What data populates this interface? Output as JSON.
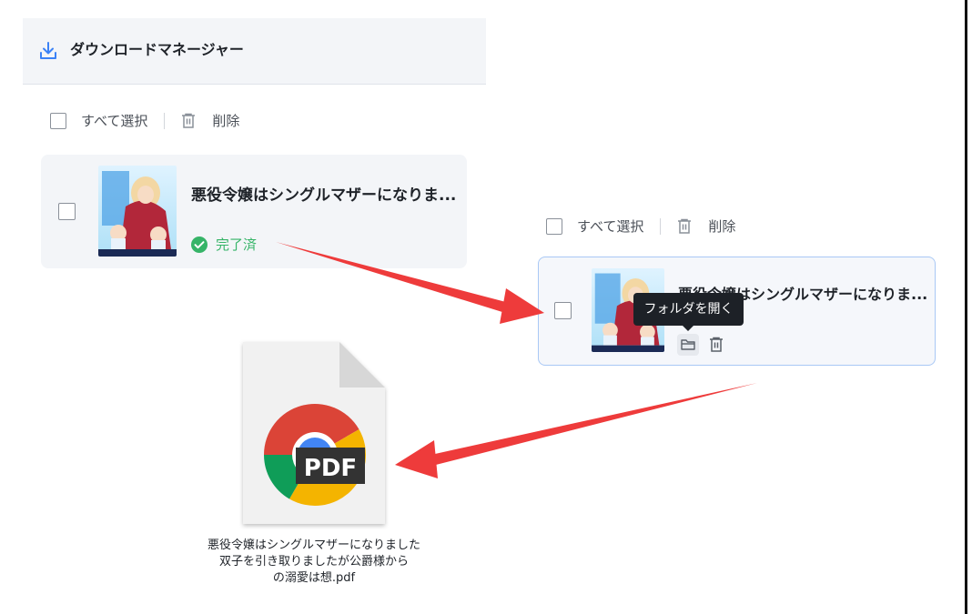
{
  "header": {
    "title": "ダウンロードマネージャー",
    "icon": "download-icon"
  },
  "toolbar": {
    "select_all": "すべて選択",
    "delete": "削除"
  },
  "toolbar2": {
    "select_all": "すべて選択",
    "delete": "削除"
  },
  "item1": {
    "title": "悪役令嬢はシングルマザーになりま...",
    "status": "完了済"
  },
  "item2": {
    "title": "悪役令嬢はシングルマザーになりま...",
    "tooltip": "フォルダを開く"
  },
  "file": {
    "badge": "PDF",
    "name_lines": [
      "悪役令嬢はシングルマザーになりました",
      "双子を引き取りましたが公爵様から",
      "の溺愛は想.pdf"
    ]
  },
  "colors": {
    "accent": "#3b82f6",
    "success": "#36b468",
    "arrow": "#ee3b3b"
  }
}
